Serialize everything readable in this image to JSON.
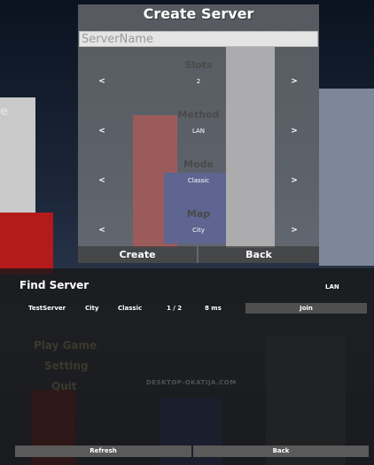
{
  "create_server": {
    "title": "Create Server",
    "server_name_placeholder": "ServerName",
    "slots": {
      "label": "Slots",
      "value": "2"
    },
    "method": {
      "label": "Method",
      "value": "LAN"
    },
    "mode": {
      "label": "Mode",
      "value": "Classic"
    },
    "map": {
      "label": "Map",
      "value": "City"
    },
    "prev_arrow": "<",
    "next_arrow": ">",
    "create_label": "Create",
    "back_label": "Back"
  },
  "find_server": {
    "title": "Find Server",
    "filter": "LAN",
    "servers": [
      {
        "name": "TestServer",
        "map": "City",
        "mode": "Classic",
        "players": "1 / 2",
        "ping": "8 ms",
        "join_label": "Join"
      }
    ],
    "refresh_label": "Refresh",
    "back_label": "Back"
  },
  "background_menu": [
    "Play Game",
    "Setting",
    "Quit"
  ],
  "edge_letter": "e",
  "watermark": "DESKTOP-OKATIJA.COM",
  "colors": {
    "panel": "#969696",
    "bar": "#5a5a5a",
    "accent_red": "#b01818",
    "accent_blue": "#1a2a8a"
  }
}
